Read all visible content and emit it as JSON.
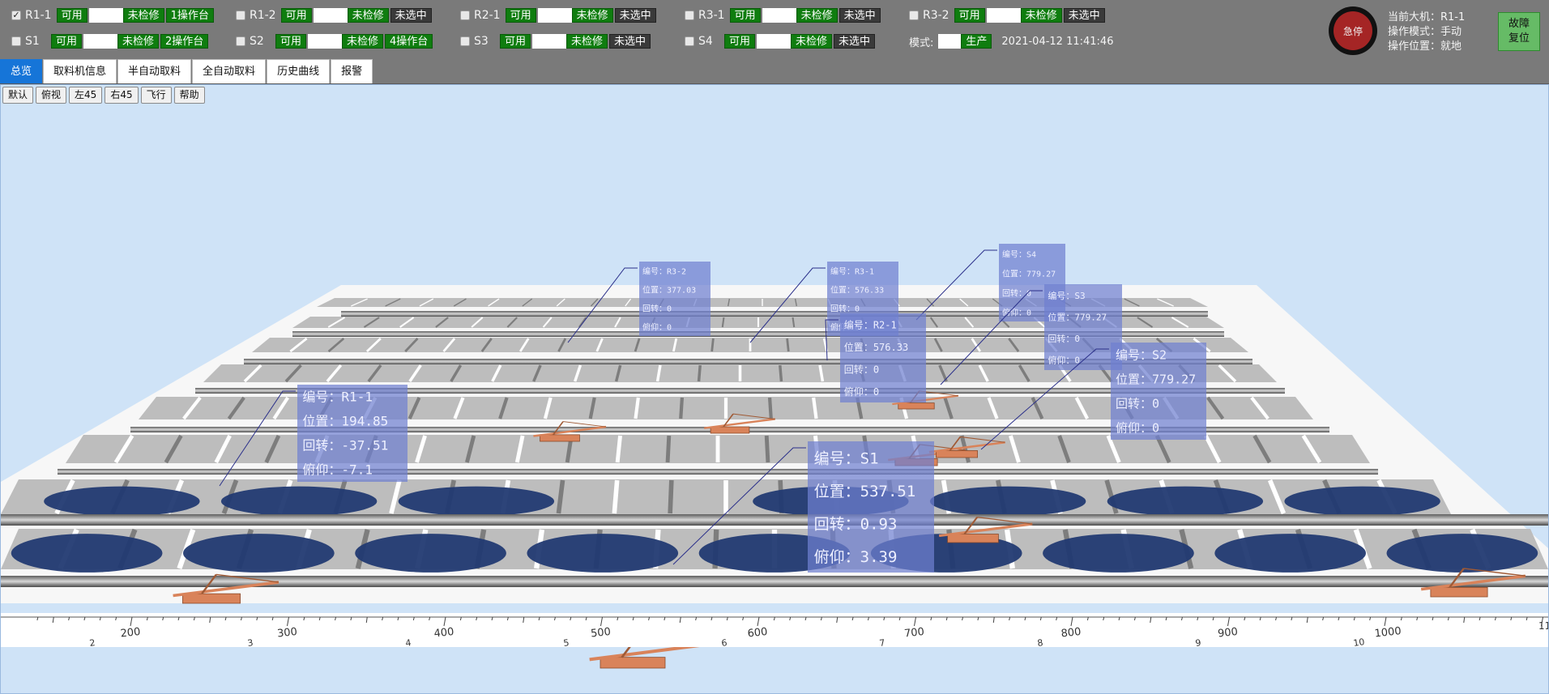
{
  "machines": [
    {
      "id": "R1-1",
      "checked": true,
      "avail": "可用",
      "maint": "未检修",
      "station": "1操作台",
      "station_color": "green"
    },
    {
      "id": "R1-2",
      "checked": false,
      "avail": "可用",
      "maint": "未检修",
      "station": "未选中",
      "station_color": "dark"
    },
    {
      "id": "R2-1",
      "checked": false,
      "avail": "可用",
      "maint": "未检修",
      "station": "未选中",
      "station_color": "dark"
    },
    {
      "id": "R3-1",
      "checked": false,
      "avail": "可用",
      "maint": "未检修",
      "station": "未选中",
      "station_color": "dark"
    },
    {
      "id": "R3-2",
      "checked": false,
      "avail": "可用",
      "maint": "未检修",
      "station": "未选中",
      "station_color": "dark"
    },
    {
      "id": "S1",
      "checked": false,
      "avail": "可用",
      "maint": "未检修",
      "station": "2操作台",
      "station_color": "green"
    },
    {
      "id": "S2",
      "checked": false,
      "avail": "可用",
      "maint": "未检修",
      "station": "4操作台",
      "station_color": "green"
    },
    {
      "id": "S3",
      "checked": false,
      "avail": "可用",
      "maint": "未检修",
      "station": "未选中",
      "station_color": "dark"
    },
    {
      "id": "S4",
      "checked": false,
      "avail": "可用",
      "maint": "未检修",
      "station": "未选中",
      "station_color": "dark"
    }
  ],
  "mode": {
    "label": "模式:",
    "value": "生产",
    "timestamp": "2021-04-12 11:41:46"
  },
  "estop": {
    "label": "急停"
  },
  "status": {
    "current_machine": "当前大机：R1-1",
    "operate_mode": "操作模式：手动",
    "operate_location": "操作位置：就地"
  },
  "fault_reset": {
    "line1": "故障",
    "line2": "复位"
  },
  "tabs": [
    {
      "label": "总览",
      "active": true
    },
    {
      "label": "取料机信息",
      "active": false
    },
    {
      "label": "半自动取料",
      "active": false
    },
    {
      "label": "全自动取料",
      "active": false
    },
    {
      "label": "历史曲线",
      "active": false
    },
    {
      "label": "报警",
      "active": false
    }
  ],
  "view_buttons": [
    "默认",
    "俯视",
    "左45",
    "右45",
    "飞行",
    "帮助"
  ],
  "info_fields": [
    "编号",
    "位置",
    "回转",
    "俯仰"
  ],
  "info_cards": [
    {
      "id": "R3-2",
      "pos": "377.03",
      "rot": "0",
      "pitch": "0"
    },
    {
      "id": "R3-1",
      "pos": "576.33",
      "rot": "0",
      "pitch": "0"
    },
    {
      "id": "S4",
      "pos": "779.27",
      "rot": "0",
      "pitch": "0"
    },
    {
      "id": "R2-1",
      "pos": "576.33",
      "rot": "0",
      "pitch": "0"
    },
    {
      "id": "S3",
      "pos": "779.27",
      "rot": "0",
      "pitch": "0"
    },
    {
      "id": "S2",
      "pos": "779.27",
      "rot": "0",
      "pitch": "0"
    },
    {
      "id": "R1-1",
      "pos": "194.85",
      "rot": "-37.51",
      "pitch": "-7.1"
    },
    {
      "id": "S1",
      "pos": "537.51",
      "rot": "0.93",
      "pitch": "3.39"
    }
  ],
  "ruler": {
    "major": [
      "200",
      "300",
      "400",
      "500",
      "600",
      "700",
      "800",
      "900",
      "1000"
    ],
    "minor": [
      "2",
      "3",
      "4",
      "5",
      "6",
      "7",
      "8",
      "9",
      "10"
    ],
    "cut_label": "11"
  },
  "colors": {
    "topbar": "#7a7a7a",
    "green": "#0f7d0f",
    "dark": "#3a3a3a",
    "active_tab": "#1675d8",
    "sky": "#cfe3f7",
    "coal": "#223a72",
    "info_card": "#6f7fd0",
    "machine": "#d9835a"
  }
}
